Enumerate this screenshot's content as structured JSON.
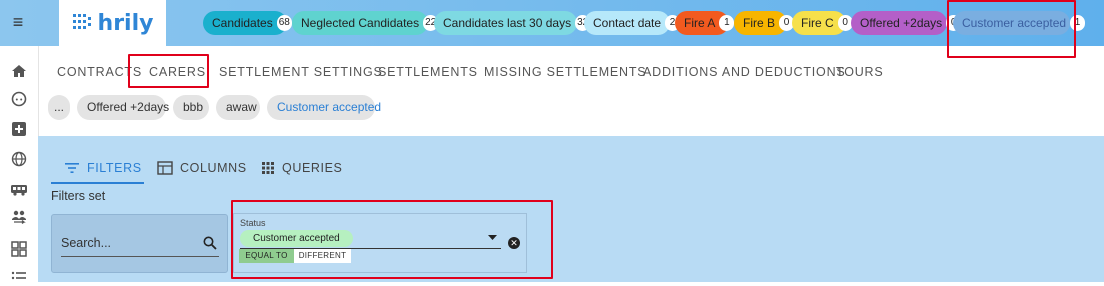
{
  "topbar": {
    "logo_text": "hrily",
    "chips": [
      {
        "label": "Candidates",
        "count": "68",
        "bg": "#1ab0cd"
      },
      {
        "label": "Neglected Candidates",
        "count": "22",
        "bg": "#5fd3cf"
      },
      {
        "label": "Candidates last 30 days",
        "count": "32",
        "bg": "#7ed9e2"
      },
      {
        "label": "Contact date",
        "count": "2",
        "bg": "#b6e8fa"
      },
      {
        "label": "Fire A",
        "count": "1",
        "bg": "#f25a1f"
      },
      {
        "label": "Fire B",
        "count": "0",
        "bg": "#f7b500"
      },
      {
        "label": "Fire C",
        "count": "0",
        "bg": "#f6e04b"
      },
      {
        "label": "Offered +2days",
        "count": "0",
        "bg": "#b45fc8"
      },
      {
        "label": "Customer accepted",
        "count": "1",
        "bg": "#7aaee0"
      }
    ]
  },
  "tabs": [
    "CONTRACTS",
    "CARERS",
    "SETTLEMENT SETTINGS",
    "SETTLEMENTS",
    "MISSING SETTLEMENTS",
    "ADDITIONS AND DEDUCTIONS",
    "TOURS"
  ],
  "saved_filters": [
    "...",
    "Offered +2days",
    "bbb",
    "awaw",
    "Customer accepted"
  ],
  "panel": {
    "tabs": {
      "filters": "FILTERS",
      "columns": "COLUMNS",
      "queries": "QUERIES"
    },
    "filters_set_label": "Filters set",
    "search_placeholder": "Search...",
    "status_filter": {
      "label": "Status",
      "value": "Customer accepted",
      "equal_label": "EQUAL TO",
      "different_label": "DIFFERENT"
    }
  },
  "colors": {
    "highlight": "#e0001b",
    "accent": "#2a7fd4",
    "panel_bg": "#b8dbf4"
  }
}
